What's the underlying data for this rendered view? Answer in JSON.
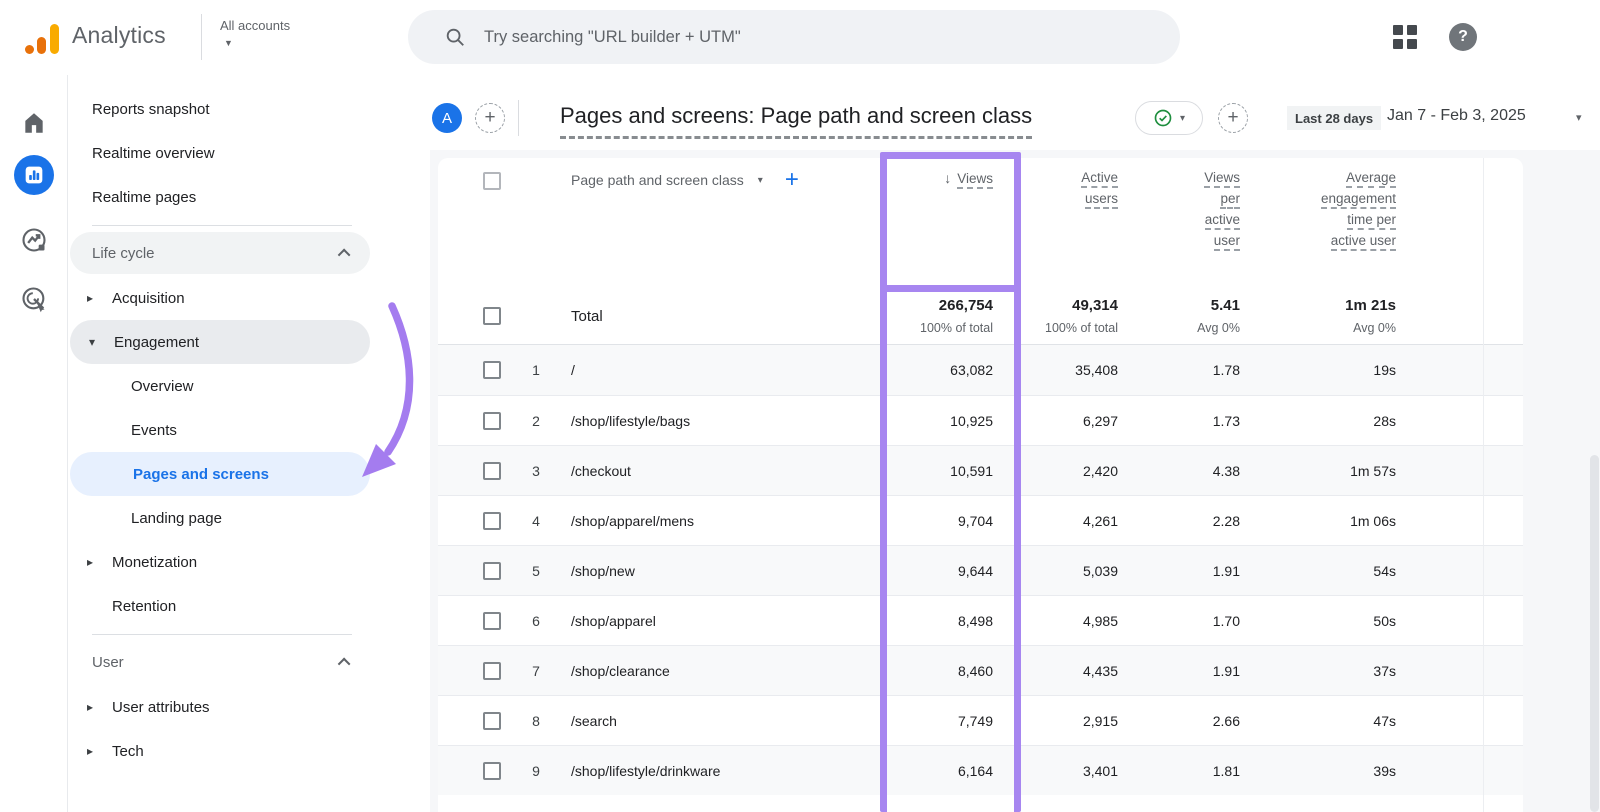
{
  "topbar": {
    "brand": "Analytics",
    "account_switcher": "All accounts",
    "search_placeholder": "Try searching \"URL builder + UTM\"",
    "avatar_letter": "A"
  },
  "rail": [
    {
      "name": "home",
      "active": false
    },
    {
      "name": "reports",
      "active": true
    },
    {
      "name": "explore",
      "active": false
    },
    {
      "name": "advertising",
      "active": false
    }
  ],
  "sidebar": {
    "nav": [
      {
        "t": "item",
        "label": "Reports snapshot"
      },
      {
        "t": "item",
        "label": "Realtime overview"
      },
      {
        "t": "item",
        "label": "Realtime pages"
      },
      {
        "t": "divider"
      },
      {
        "t": "section",
        "label": "Life cycle",
        "pill": true
      },
      {
        "t": "parent",
        "label": "Acquisition",
        "caret": "right"
      },
      {
        "t": "parent",
        "label": "Engagement",
        "caret": "down",
        "pill": true
      },
      {
        "t": "child",
        "label": "Overview"
      },
      {
        "t": "child",
        "label": "Events"
      },
      {
        "t": "child",
        "label": "Pages and screens",
        "selected": true
      },
      {
        "t": "child",
        "label": "Landing page"
      },
      {
        "t": "parent",
        "label": "Monetization",
        "caret": "right"
      },
      {
        "t": "parent",
        "label": "Retention"
      },
      {
        "t": "divider"
      },
      {
        "t": "section",
        "label": "User"
      },
      {
        "t": "parent",
        "label": "User attributes",
        "caret": "right"
      },
      {
        "t": "parent",
        "label": "Tech",
        "caret": "right"
      }
    ]
  },
  "report_header": {
    "title": "Pages and screens: Page path and screen class",
    "date_label": "Last 28 days",
    "date_range": "Jan 7 - Feb 3, 2025"
  },
  "table": {
    "dimension_header": "Page path and screen class",
    "metric_columns": [
      {
        "id": "views",
        "lines": [
          "Views"
        ],
        "sorted": true
      },
      {
        "id": "active-users",
        "lines": [
          "Active",
          "users"
        ]
      },
      {
        "id": "views-per-active-user",
        "lines": [
          "Views",
          "per",
          "active",
          "user"
        ]
      },
      {
        "id": "avg-engagement-time-per-active-user",
        "lines": [
          "Average",
          "engagement",
          "time per",
          "active user"
        ]
      }
    ],
    "total": {
      "label": "Total",
      "views": "266,754",
      "views_sub": "100% of total",
      "active_users": "49,314",
      "active_users_sub": "100% of total",
      "views_per_active_user": "5.41",
      "views_per_active_user_sub": "Avg 0%",
      "avg_engagement_time": "1m 21s",
      "avg_engagement_time_sub": "Avg 0%"
    },
    "rows": [
      {
        "n": "1",
        "path": "/",
        "views": "63,082",
        "active_users": "35,408",
        "views_per_active_user": "1.78",
        "avg_engagement_time": "19s"
      },
      {
        "n": "2",
        "path": "/shop/lifestyle/bags",
        "views": "10,925",
        "active_users": "6,297",
        "views_per_active_user": "1.73",
        "avg_engagement_time": "28s"
      },
      {
        "n": "3",
        "path": "/checkout",
        "views": "10,591",
        "active_users": "2,420",
        "views_per_active_user": "4.38",
        "avg_engagement_time": "1m 57s"
      },
      {
        "n": "4",
        "path": "/shop/apparel/mens",
        "views": "9,704",
        "active_users": "4,261",
        "views_per_active_user": "2.28",
        "avg_engagement_time": "1m 06s"
      },
      {
        "n": "5",
        "path": "/shop/new",
        "views": "9,644",
        "active_users": "5,039",
        "views_per_active_user": "1.91",
        "avg_engagement_time": "54s"
      },
      {
        "n": "6",
        "path": "/shop/apparel",
        "views": "8,498",
        "active_users": "4,985",
        "views_per_active_user": "1.70",
        "avg_engagement_time": "50s"
      },
      {
        "n": "7",
        "path": "/shop/clearance",
        "views": "8,460",
        "active_users": "4,435",
        "views_per_active_user": "1.91",
        "avg_engagement_time": "37s"
      },
      {
        "n": "8",
        "path": "/search",
        "views": "7,749",
        "active_users": "2,915",
        "views_per_active_user": "2.66",
        "avg_engagement_time": "47s"
      },
      {
        "n": "9",
        "path": "/shop/lifestyle/drinkware",
        "views": "6,164",
        "active_users": "3,401",
        "views_per_active_user": "1.81",
        "avg_engagement_time": "39s"
      }
    ]
  },
  "annotations": {
    "highlight_color": "#a786f0",
    "arrow_color": "#a47cef",
    "sort_icon": "↓",
    "caret_down_icon": "▾",
    "caret_right_icon": "▸",
    "plus_icon": "+"
  }
}
